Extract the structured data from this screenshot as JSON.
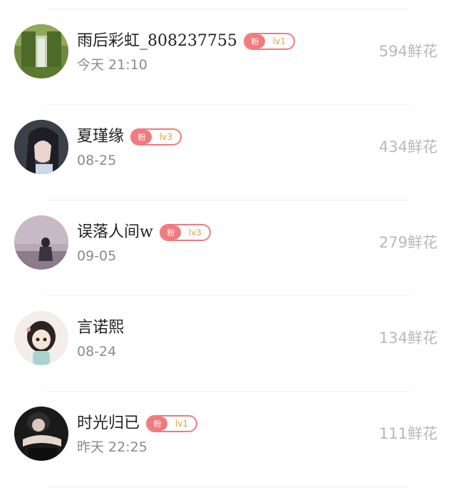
{
  "badge_prefix": "粉",
  "users": [
    {
      "name": "雨后彩虹_808237755",
      "time": "今天 21:10",
      "level": "lv1",
      "flowers": "594鲜花"
    },
    {
      "name": "夏瑾缘",
      "time": "08-25",
      "level": "lv3",
      "flowers": "434鲜花"
    },
    {
      "name": "误落人间w",
      "time": "09-05",
      "level": "lv3",
      "flowers": "279鲜花"
    },
    {
      "name": "言诺熙",
      "time": "08-24",
      "level": "",
      "flowers": "134鲜花"
    },
    {
      "name": "时光归已",
      "time": "昨天 22:25",
      "level": "lv1",
      "flowers": "111鲜花"
    }
  ],
  "colors": {
    "badge": "#f07a7d",
    "level_text": "#e8a03a",
    "flower_text": "#b8b8b8"
  }
}
